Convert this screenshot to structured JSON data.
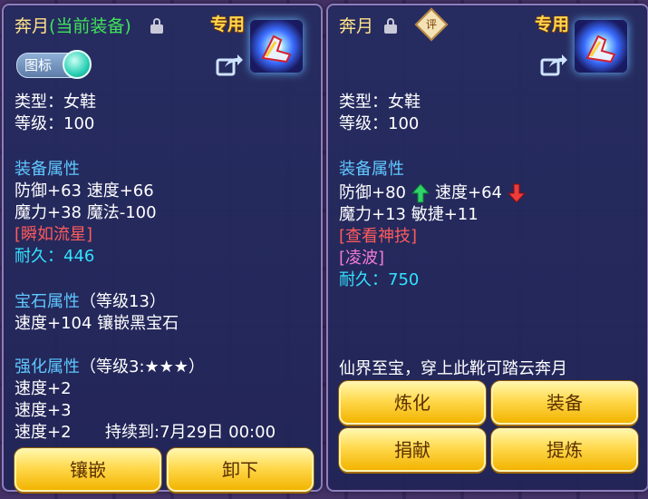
{
  "left": {
    "item_name": "奔月",
    "equipped_tag": "(当前装备)",
    "exclusive": "专用",
    "icon_toggle_label": "图标",
    "type": "类型：女鞋",
    "level": "等级：100",
    "attr_title": "装备属性",
    "attr_line1": "防御+63 速度+66",
    "attr_line2": "魔力+38 魔法-100",
    "skill": "[瞬如流星]",
    "durability": "耐久：446",
    "gem_title": "宝石属性",
    "gem_level": "（等级13）",
    "gem_line": "速度+104 镶嵌黑宝石",
    "enhance_title": "强化属性",
    "enhance_level": "（等级3:★★★）",
    "enhance_1": "速度+2",
    "enhance_2": "速度+3",
    "enhance_3": "速度+2",
    "enhance_duration": "持续到:7月29日 00:00",
    "buttons": {
      "inlay": "镶嵌",
      "unequip": "卸下"
    }
  },
  "right": {
    "item_name": "奔月",
    "rate_badge": "评",
    "exclusive": "专用",
    "type": "类型：女鞋",
    "level": "等级：100",
    "attr_title": "装备属性",
    "def": "防御+80",
    "spd": "速度+64",
    "attr_line2": "魔力+13 敏捷+11",
    "skill_view": "[查看神技]",
    "special": "[凌波]",
    "durability": "耐久：750",
    "description": "仙界至宝，穿上此靴可踏云奔月",
    "buttons": {
      "refine": "炼化",
      "equip": "装备",
      "donate": "捐献",
      "extract": "提炼"
    }
  },
  "colors": {
    "green": "#3fe35a",
    "section": "#5fc8ff",
    "skill": "#ff5b5b",
    "special": "#f37bd6",
    "durability": "#33e2ff",
    "gold": "#ffd84a"
  },
  "icons": [
    "lock-icon",
    "share-icon",
    "equipment-icon",
    "arrow-up-icon",
    "arrow-down-icon"
  ]
}
